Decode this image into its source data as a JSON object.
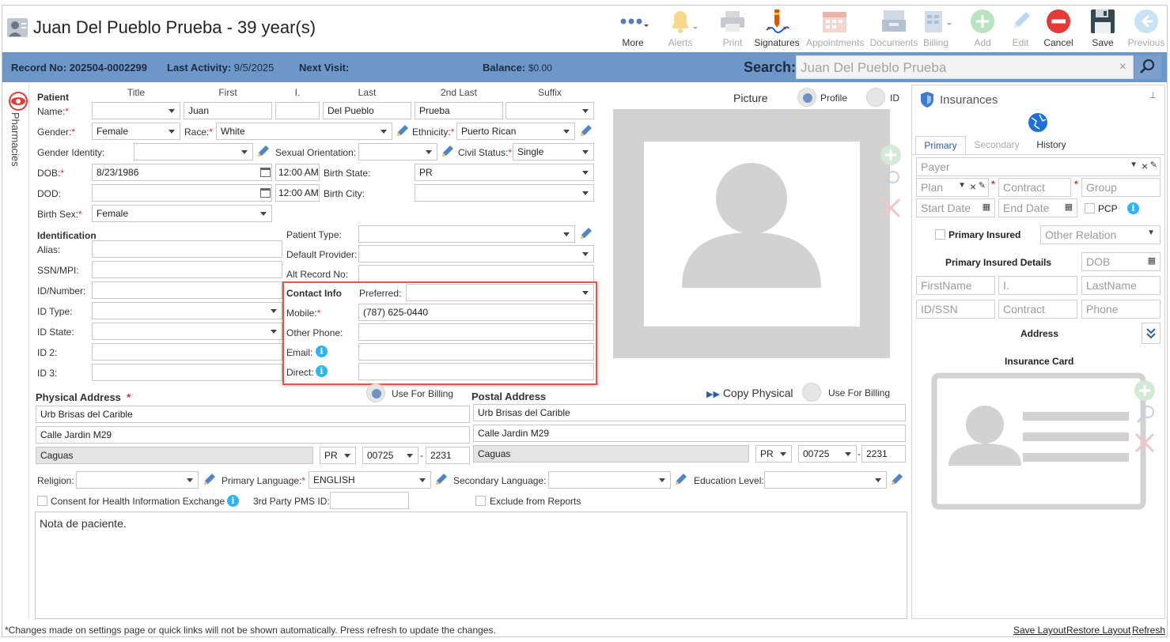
{
  "header": {
    "title": "Juan Del Pueblo Prueba - 39 year(s)",
    "toolbar": {
      "more": "More",
      "alerts": "Alerts",
      "print": "Print",
      "signatures": "Signatures",
      "appointments": "Appointments",
      "documents": "Documents",
      "billing": "Billing",
      "add": "Add",
      "edit": "Edit",
      "cancel": "Cancel",
      "save": "Save",
      "previous": "Previous"
    }
  },
  "bar": {
    "record_label": "Record No:",
    "record_value": "202504-0002299",
    "activity_label": "Last Activity:",
    "activity_value": "9/5/2025",
    "next_label": "Next Visit:",
    "balance_label": "Balance:",
    "balance_value": "$0.00",
    "search_label": "Search:",
    "search_value": "Juan Del Pueblo Prueba",
    "search_clear": "×"
  },
  "side_tab": "Pharmacies",
  "patient": {
    "section": "Patient",
    "col_title": "Title",
    "col_first": "First",
    "col_i": "I.",
    "col_last": "Last",
    "col_2nd_last": "2nd Last",
    "col_suffix": "Suffix",
    "name_label": "Name:",
    "first": "Juan",
    "last": "Del Pueblo",
    "second_last": "Prueba",
    "gender_label": "Gender:",
    "gender": "Female",
    "race_label": "Race:",
    "race": "White",
    "ethnicity_label": "Ethnicity:",
    "ethnicity": "Puerto Rican",
    "gender_identity_label": "Gender Identity:",
    "sexual_orientation_label": "Sexual Orientation:",
    "civil_status_label": "Civil Status:",
    "civil_status": "Single",
    "dob_label": "DOB:",
    "dob": "8/23/1986",
    "dob_time": "12:00 AM",
    "birth_state_label": "Birth State:",
    "birth_state": "PR",
    "dod_label": "DOD:",
    "dod_time": "12:00 AM",
    "birth_city_label": "Birth City:",
    "birth_sex_label": "Birth Sex:",
    "birth_sex": "Female"
  },
  "identification": {
    "section": "Identification",
    "alias": "Alias:",
    "ssn": "SSN/MPI:",
    "id_number": "ID/Number:",
    "id_type": "ID Type:",
    "id_state": "ID State:",
    "id2": "ID 2:",
    "id3": "ID 3:",
    "patient_type": "Patient Type:",
    "default_provider": "Default Provider:",
    "alt_record": "Alt Record No:"
  },
  "contact": {
    "section": "Contact Info",
    "preferred": "Preferred:",
    "mobile_label": "Mobile:",
    "mobile": "(787) 625-0440",
    "other_phone": "Other Phone:",
    "email": "Email:",
    "direct": "Direct:"
  },
  "picture": {
    "label": "Picture",
    "profile": "Profile",
    "id": "ID"
  },
  "physical": {
    "section": "Physical Address",
    "use_billing": "Use For Billing",
    "line1": "Urb Brisas del Carible",
    "line2": "Calle Jardin M29",
    "city": "Caguas",
    "state": "PR",
    "zip": "00725",
    "zip4": "2231"
  },
  "postal": {
    "section": "Postal Address",
    "copy": "Copy Physical",
    "use_billing": "Use For Billing",
    "line1": "Urb Brisas del Carible",
    "line2": "Calle Jardin M29",
    "city": "Caguas",
    "state": "PR",
    "zip": "00725",
    "zip4": "2231"
  },
  "misc": {
    "religion": "Religion:",
    "primary_language_label": "Primary Language:",
    "primary_language": "ENGLISH",
    "secondary_language": "Secondary Language:",
    "education": "Education Level:",
    "consent": "Consent for Health Information Exchange",
    "third_party": "3rd Party PMS ID:",
    "exclude": "Exclude from Reports",
    "notes": "Nota de paciente."
  },
  "insurance": {
    "title": "Insurances",
    "tabs": [
      "Primary",
      "Secondary",
      "History"
    ],
    "payer": "Payer",
    "plan": "Plan",
    "contract": "Contract",
    "group": "Group",
    "start_date": "Start Date",
    "end_date": "End Date",
    "pcp": "PCP",
    "primary_insured": "Primary Insured",
    "other_relation": "Other Relation",
    "details": "Primary Insured Details",
    "dob": "DOB",
    "firstname": "FirstName",
    "initial": "I.",
    "lastname": "LastName",
    "idssn": "ID/SSN",
    "contract2": "Contract",
    "phone": "Phone",
    "address": "Address",
    "card": "Insurance Card"
  },
  "footer": {
    "note": "*Changes made on settings page or quick links will not be shown automatically. Press refresh to update the changes.",
    "save_layout": "Save Layout",
    "restore_layout": "Restore Layout",
    "refresh": "Refresh"
  },
  "colors": {
    "bar": "#6e97c9",
    "highlight": "#e0584a",
    "info": "#29b6f6",
    "required": "#d32f2f"
  }
}
